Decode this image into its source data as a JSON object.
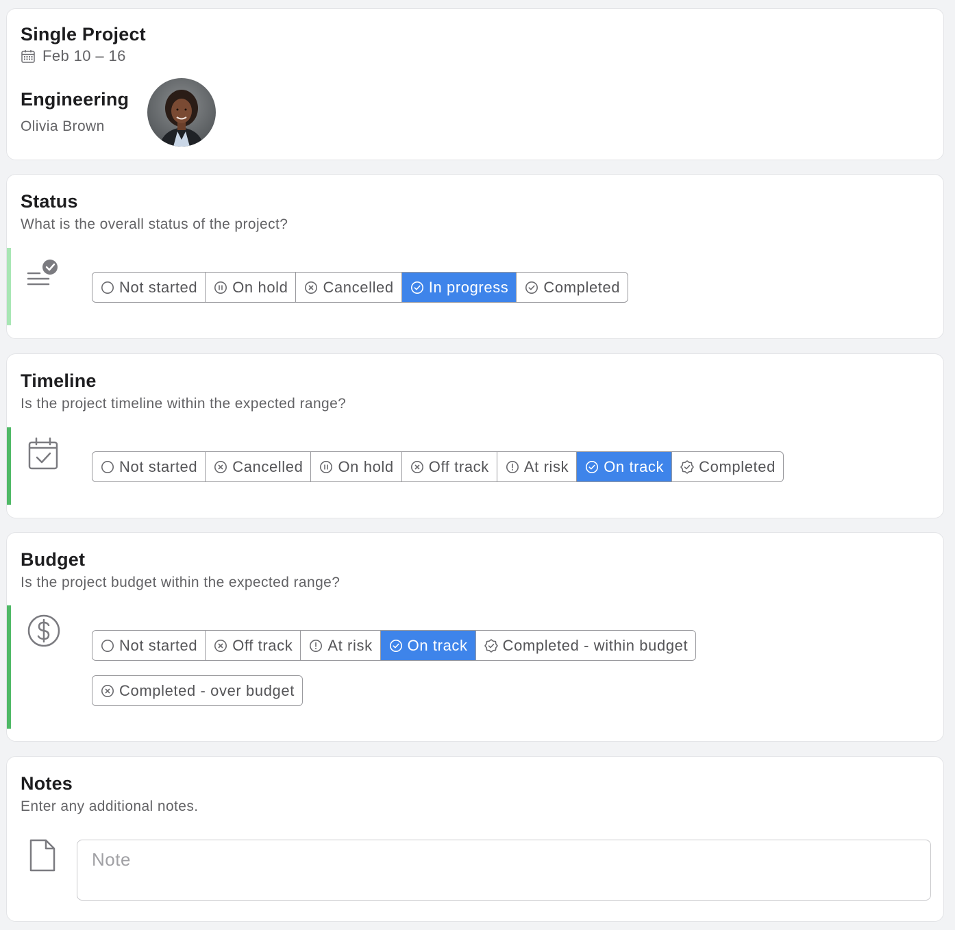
{
  "project": {
    "title": "Single Project",
    "date_range": "Feb 10 – 16",
    "team": "Engineering",
    "owner": "Olivia Brown"
  },
  "status": {
    "title": "Status",
    "question": "What is the overall status of the project?",
    "accent_color": "#a8e6b4",
    "options": [
      {
        "label": "Not started",
        "icon": "empty-circle-icon",
        "selected": false
      },
      {
        "label": "On hold",
        "icon": "pause-circle-icon",
        "selected": false
      },
      {
        "label": "Cancelled",
        "icon": "x-circle-icon",
        "selected": false
      },
      {
        "label": "In progress",
        "icon": "check-circle-icon",
        "selected": true
      },
      {
        "label": "Completed",
        "icon": "check-circle-icon",
        "selected": false
      }
    ]
  },
  "timeline": {
    "title": "Timeline",
    "question": "Is the project timeline within the expected range?",
    "accent_color": "#4fb966",
    "options": [
      {
        "label": "Not started",
        "icon": "empty-circle-icon",
        "selected": false
      },
      {
        "label": "Cancelled",
        "icon": "x-circle-icon",
        "selected": false
      },
      {
        "label": "On hold",
        "icon": "pause-circle-icon",
        "selected": false
      },
      {
        "label": "Off track",
        "icon": "x-circle-icon",
        "selected": false
      },
      {
        "label": "At risk",
        "icon": "alert-circle-icon",
        "selected": false
      },
      {
        "label": "On track",
        "icon": "check-circle-icon",
        "selected": true
      },
      {
        "label": "Completed",
        "icon": "badge-check-icon",
        "selected": false
      }
    ]
  },
  "budget": {
    "title": "Budget",
    "question": "Is the project budget within the expected range?",
    "accent_color": "#4fb966",
    "options_row1": [
      {
        "label": "Not started",
        "icon": "empty-circle-icon",
        "selected": false
      },
      {
        "label": "Off track",
        "icon": "x-circle-icon",
        "selected": false
      },
      {
        "label": "At risk",
        "icon": "alert-circle-icon",
        "selected": false
      },
      {
        "label": "On track",
        "icon": "check-circle-icon",
        "selected": true
      },
      {
        "label": "Completed - within budget",
        "icon": "badge-check-icon",
        "selected": false
      }
    ],
    "options_row2": [
      {
        "label": "Completed - over budget",
        "icon": "x-circle-icon",
        "selected": false
      }
    ]
  },
  "notes": {
    "title": "Notes",
    "question": "Enter any additional notes.",
    "placeholder": "Note",
    "value": ""
  },
  "colors": {
    "selected": "#3e84ea",
    "border": "#9a9a9e",
    "muted_text": "#636366"
  }
}
